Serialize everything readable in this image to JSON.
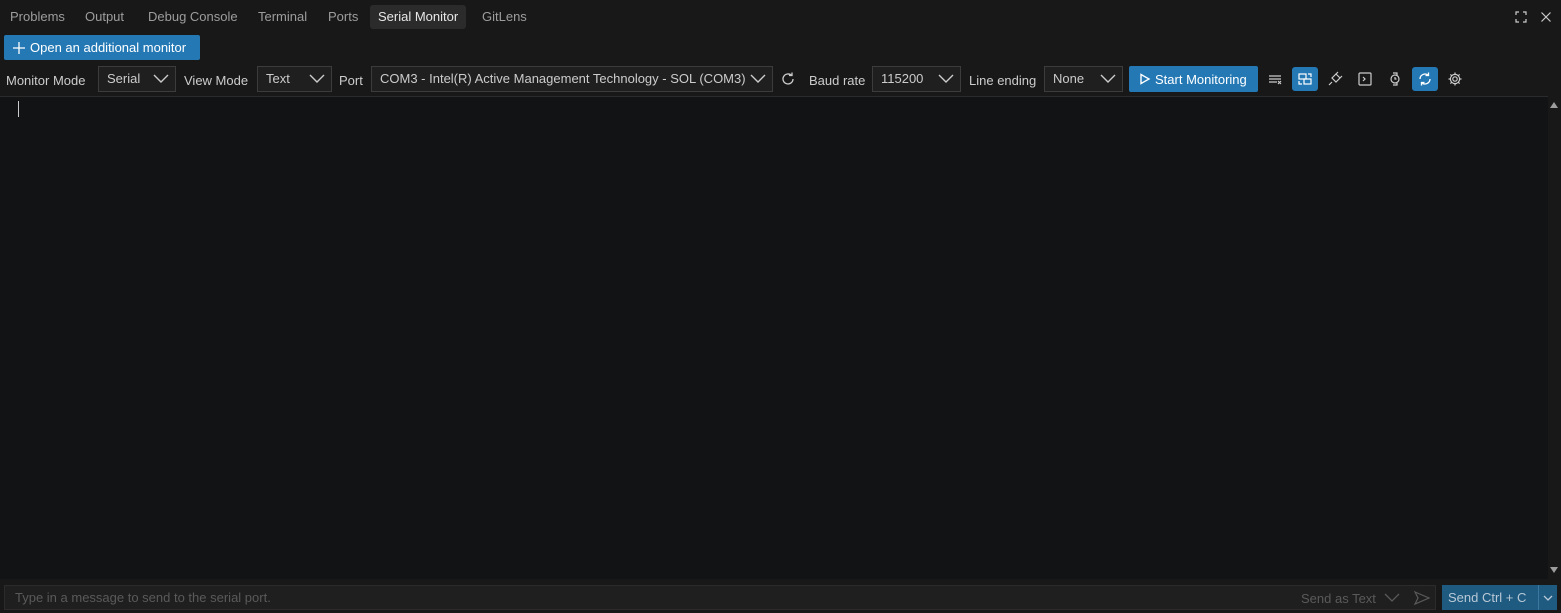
{
  "tabs": [
    {
      "label": "Problems"
    },
    {
      "label": "Output"
    },
    {
      "label": "Debug Console"
    },
    {
      "label": "Terminal"
    },
    {
      "label": "Ports"
    },
    {
      "label": "Serial Monitor",
      "active": true
    },
    {
      "label": "GitLens"
    }
  ],
  "window": {
    "maximize_icon": "maximize-icon",
    "close_icon": "close-icon"
  },
  "open_monitor_label": "Open an additional monitor",
  "toolbar": {
    "monitor_mode_label": "Monitor Mode",
    "monitor_mode_value": "Serial",
    "view_mode_label": "View Mode",
    "view_mode_value": "Text",
    "port_label": "Port",
    "port_value": "COM3 - Intel(R) Active Management Technology - SOL (COM3)",
    "baud_label": "Baud rate",
    "baud_value": "115200",
    "line_ending_label": "Line ending",
    "line_ending_value": "None",
    "start_label": "Start Monitoring"
  },
  "input": {
    "placeholder": "Type in a message to send to the serial port.",
    "send_mode": "Send as Text",
    "send_label": "Send Ctrl + C"
  },
  "colors": {
    "accent": "#2479b5",
    "background": "#181818",
    "output_bg": "#121314"
  }
}
